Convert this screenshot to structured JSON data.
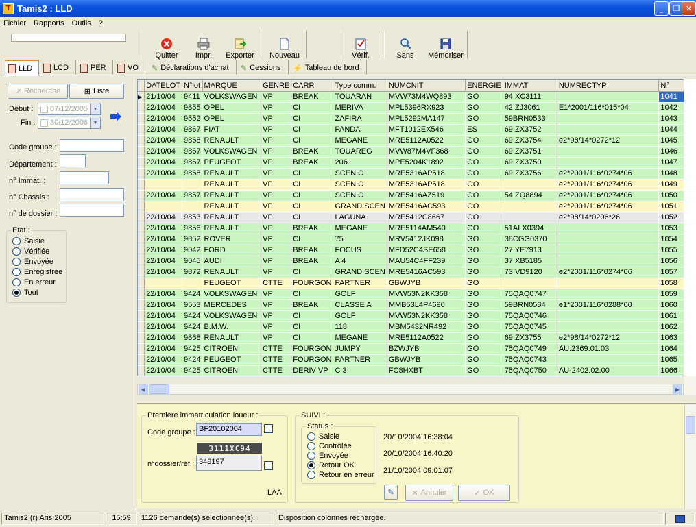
{
  "window": {
    "title": "Tamis2 : LLD",
    "app_icon_letter": "T"
  },
  "menu": [
    "Fichier",
    "Rapports",
    "Outils",
    "?"
  ],
  "toolbar": [
    {
      "label": "Quitter",
      "icon": "close-circle-icon"
    },
    {
      "label": "Impr.",
      "icon": "printer-icon"
    },
    {
      "label": "Exporter",
      "icon": "export-icon"
    },
    {
      "label": "Nouveau",
      "icon": "new-document-icon"
    },
    {
      "label": "Vérif.",
      "icon": "checklist-icon"
    },
    {
      "label": "Sans",
      "icon": "magnifier-icon"
    },
    {
      "label": "Mémoriser",
      "icon": "save-disk-icon"
    }
  ],
  "tabs": [
    "LLD",
    "LCD",
    "PER",
    "VO",
    "Déclarations d'achat",
    "Cessions",
    "Tableau de bord"
  ],
  "left": {
    "recherche_label": "Recherche",
    "liste_label": "Liste",
    "debut_label": "Début :",
    "debut_value": "07/12/2005",
    "fin_label": "Fin :",
    "fin_value": "30/12/2006",
    "fields": [
      {
        "label": "Code groupe :",
        "value": ""
      },
      {
        "label": "Département :",
        "value": ""
      },
      {
        "label": "n° Immat. :",
        "value": ""
      },
      {
        "label": "n° Chassis :",
        "value": ""
      },
      {
        "label": "n° de dossier :",
        "value": ""
      }
    ],
    "etat_title": "Etat :",
    "etat_options": [
      "Saisie",
      "Vérifiée",
      "Envoyée",
      "Enregistrée",
      "En erreur",
      "Tout"
    ],
    "etat_selected": "Tout"
  },
  "grid": {
    "columns": [
      "DATELOT",
      "N°lot",
      "MARQUE",
      "GENRE",
      "CARR",
      "Type comm.",
      "NUMCNIT",
      "ENERGIE",
      "IMMAT",
      "NUMRECTYP",
      "N°"
    ],
    "rows": [
      {
        "c": [
          "21/10/04",
          "9411",
          "VOLKSWAGEN",
          "VP",
          "BREAK",
          "TOUARAN",
          "MVW73M4WQ893",
          "GO",
          "94 XC3111",
          "",
          "1041"
        ],
        "color": "green"
      },
      {
        "c": [
          "22/10/04",
          "9855",
          "OPEL",
          "VP",
          "CI",
          "MERIVA",
          "MPL5396RX923",
          "GO",
          "42 ZJ3061",
          "E1*2001/116*015*04",
          "1042"
        ],
        "color": "green"
      },
      {
        "c": [
          "22/10/04",
          "9552",
          "OPEL",
          "VP",
          "CI",
          "ZAFIRA",
          "MPL5292MA147",
          "GO",
          "59BRN0533",
          "",
          "1043"
        ],
        "color": "green"
      },
      {
        "c": [
          "22/10/04",
          "9867",
          "FIAT",
          "VP",
          "CI",
          "PANDA",
          "MFT1012EX546",
          "ES",
          "69 ZX3752",
          "",
          "1044"
        ],
        "color": "green"
      },
      {
        "c": [
          "22/10/04",
          "9868",
          "RENAULT",
          "VP",
          "CI",
          "MEGANE",
          "MRE5112A0522",
          "GO",
          "69 ZX3754",
          "e2*98/14*0272*12",
          "1045"
        ],
        "color": "green"
      },
      {
        "c": [
          "22/10/04",
          "9867",
          "VOLKSWAGEN",
          "VP",
          "BREAK",
          "TOUAREG",
          "MVW87M4VF368",
          "GO",
          "69 ZX3751",
          "",
          "1046"
        ],
        "color": "green"
      },
      {
        "c": [
          "22/10/04",
          "9867",
          "PEUGEOT",
          "VP",
          "BREAK",
          "206",
          "MPE5204K1892",
          "GO",
          "69 ZX3750",
          "",
          "1047"
        ],
        "color": "green"
      },
      {
        "c": [
          "22/10/04",
          "9868",
          "RENAULT",
          "VP",
          "CI",
          "SCENIC",
          "MRE5316AP518",
          "GO",
          "69 ZX3756",
          "e2*2001/116*0274*06",
          "1048"
        ],
        "color": "green"
      },
      {
        "c": [
          "",
          "",
          "RENAULT",
          "VP",
          "CI",
          "SCENIC",
          "MRE5316AP518",
          "GO",
          "",
          "e2*2001/116*0274*06",
          "1049"
        ],
        "color": "yellow"
      },
      {
        "c": [
          "22/10/04",
          "9857",
          "RENAULT",
          "VP",
          "CI",
          "SCENIC",
          "MRE5416AZ519",
          "GO",
          "54 ZQ8894",
          "e2*2001/116*0274*06",
          "1050"
        ],
        "color": "green"
      },
      {
        "c": [
          "",
          "",
          "RENAULT",
          "VP",
          "CI",
          "GRAND SCEN",
          "MRE5416AC593",
          "GO",
          "",
          "e2*2001/116*0274*06",
          "1051"
        ],
        "color": "yellow"
      },
      {
        "c": [
          "22/10/04",
          "9853",
          "RENAULT",
          "VP",
          "CI",
          "LAGUNA",
          "MRE5412C8667",
          "GO",
          "",
          "e2*98/14*0206*26",
          "1052"
        ],
        "color": "grey"
      },
      {
        "c": [
          "22/10/04",
          "9856",
          "RENAULT",
          "VP",
          "BREAK",
          "MEGANE",
          "MRE5114AM540",
          "GO",
          "51ALX0394",
          "",
          "1053"
        ],
        "color": "green"
      },
      {
        "c": [
          "22/10/04",
          "9852",
          "ROVER",
          "VP",
          "CI",
          "75",
          "MRV5412JK098",
          "GO",
          "38CGG0370",
          "",
          "1054"
        ],
        "color": "green"
      },
      {
        "c": [
          "22/10/04",
          "9042",
          "FORD",
          "VP",
          "BREAK",
          "FOCUS",
          "MFD52C4SE658",
          "GO",
          "27 YE7913",
          "",
          "1055"
        ],
        "color": "green"
      },
      {
        "c": [
          "22/10/04",
          "9045",
          "AUDI",
          "VP",
          "BREAK",
          "A 4",
          "MAU54C4FF239",
          "GO",
          "37 XB5185",
          "",
          "1056"
        ],
        "color": "green"
      },
      {
        "c": [
          "22/10/04",
          "9872",
          "RENAULT",
          "VP",
          "CI",
          "GRAND SCEN",
          "MRE5416AC593",
          "GO",
          "73 VD9120",
          "e2*2001/116*0274*06",
          "1057"
        ],
        "color": "green"
      },
      {
        "c": [
          "",
          "",
          "PEUGEOT",
          "CTTE",
          "FOURGON",
          "PARTNER",
          "GBWJYB",
          "GO",
          "",
          "",
          "1058"
        ],
        "color": "yellow"
      },
      {
        "c": [
          "22/10/04",
          "9424",
          "VOLKSWAGEN",
          "VP",
          "CI",
          "GOLF",
          "MVW53N2KK358",
          "GO",
          "75QAQ0747",
          "",
          "1059"
        ],
        "color": "green"
      },
      {
        "c": [
          "22/10/04",
          "9553",
          "MERCEDES",
          "VP",
          "BREAK",
          "CLASSE A",
          "MMB53L4P4690",
          "GO",
          "59BRN0534",
          "e1*2001/116*0288*00",
          "1060"
        ],
        "color": "green"
      },
      {
        "c": [
          "22/10/04",
          "9424",
          "VOLKSWAGEN",
          "VP",
          "CI",
          "GOLF",
          "MVW53N2KK358",
          "GO",
          "75QAQ0746",
          "",
          "1061"
        ],
        "color": "green"
      },
      {
        "c": [
          "22/10/04",
          "9424",
          "B.M.W.",
          "VP",
          "CI",
          "118",
          "MBM5432NR492",
          "GO",
          "75QAQ0745",
          "",
          "1062"
        ],
        "color": "green"
      },
      {
        "c": [
          "22/10/04",
          "9868",
          "RENAULT",
          "VP",
          "CI",
          "MEGANE",
          "MRE5112A0522",
          "GO",
          "69 ZX3755",
          "e2*98/14*0272*12",
          "1063"
        ],
        "color": "green"
      },
      {
        "c": [
          "22/10/04",
          "9425",
          "CITROEN",
          "CTTE",
          "FOURGON",
          "JUMPY",
          "BZWJYB",
          "GO",
          "75QAQ0749",
          "AU.2369.01.03",
          "1064"
        ],
        "color": "green"
      },
      {
        "c": [
          "22/10/04",
          "9424",
          "PEUGEOT",
          "CTTE",
          "FOURGON",
          "PARTNER",
          "GBWJYB",
          "GO",
          "75QAQ0743",
          "",
          "1065"
        ],
        "color": "green"
      },
      {
        "c": [
          "22/10/04",
          "9425",
          "CITROEN",
          "CTTE",
          "DERIV VP",
          "C 3",
          "FC8HXBT",
          "GO",
          "75QAQ0750",
          "AU-2402.02.00",
          "1066"
        ],
        "color": "green"
      }
    ]
  },
  "detail": {
    "premiere_title": "Première immatriculation loueur :",
    "code_groupe_label": "Code groupe :",
    "code_groupe_value": "BF20102004",
    "plate_value": "3111XC94",
    "dossier_label": "n°dossier/réf. :",
    "dossier_value": "348197",
    "laa_label": "LAA",
    "suivi_title": "SUIVI :",
    "status_title": "Status :",
    "status_options": [
      "Saisie",
      "Contrôlée",
      "Envoyée",
      "Retour OK",
      "Retour en erreur"
    ],
    "status_selected": "Retour OK",
    "timestamps": [
      "20/10/2004 16:38:04",
      "20/10/2004 16:40:20",
      "21/10/2004 09:01:07"
    ],
    "annuler_label": "Annuler",
    "ok_label": "OK"
  },
  "statusbar": {
    "app": "Tamis2 (r) Aris 2005",
    "time": "15:59",
    "selection": "1126 demande(s) selectionnée(s).",
    "message": "Disposition colonnes rechargée."
  }
}
